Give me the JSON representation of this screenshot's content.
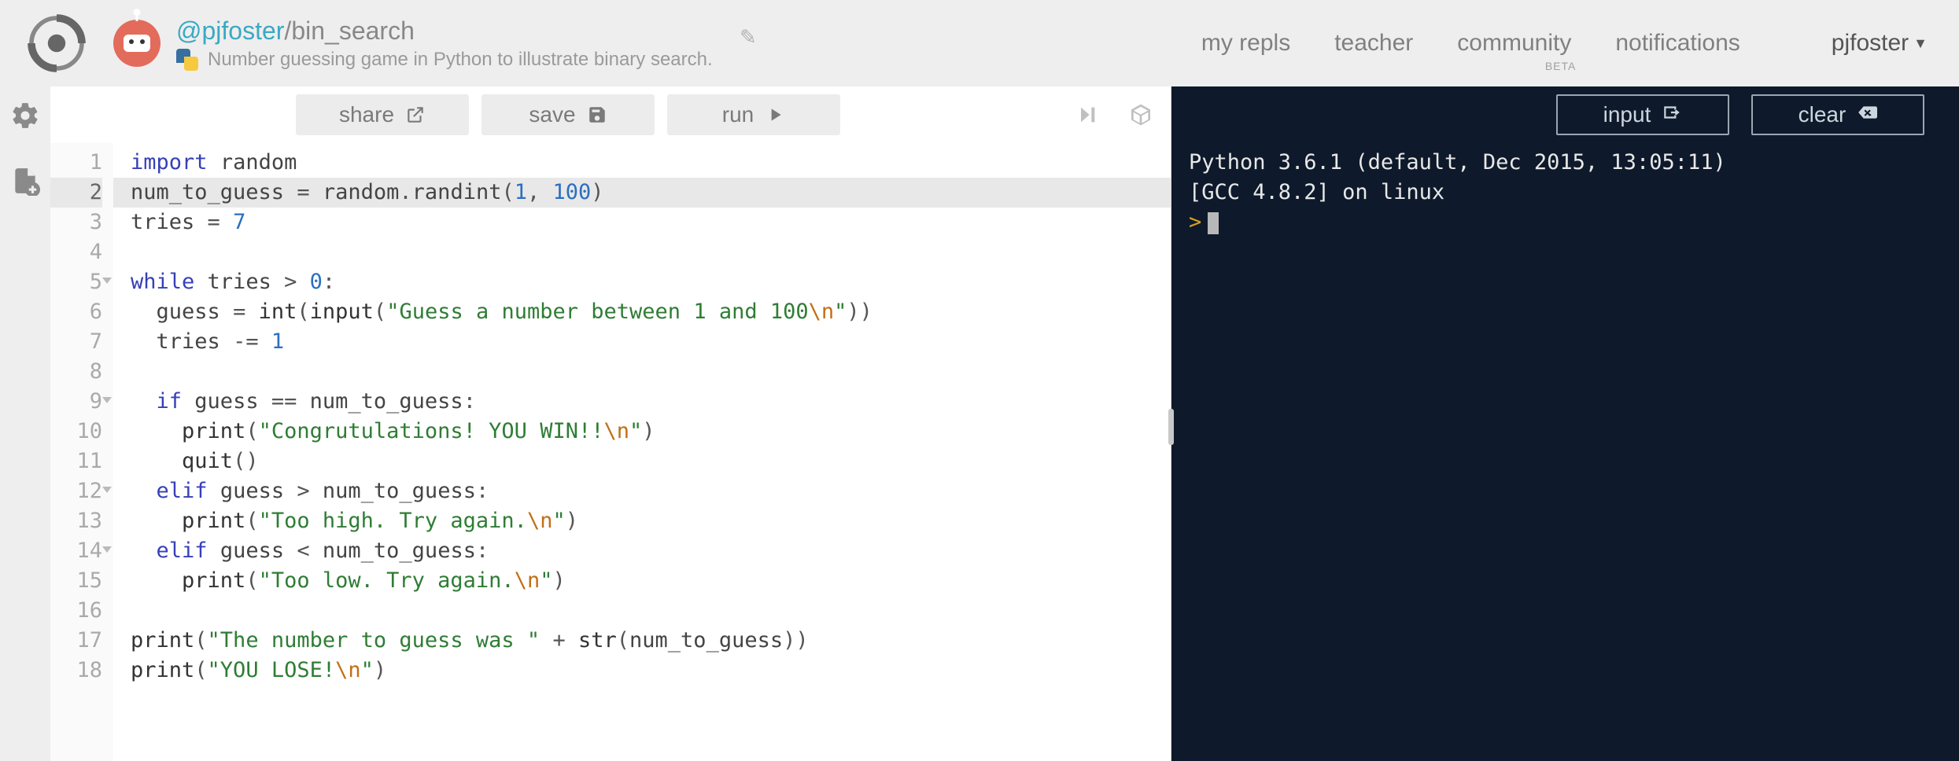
{
  "header": {
    "user_handle": "@pjfoster",
    "separator": "/",
    "repl_name": "bin_search",
    "language": "Python",
    "description": "Number guessing game in Python to illustrate binary search."
  },
  "nav": {
    "my_repls": "my repls",
    "teacher": "teacher",
    "community": "community",
    "community_beta": "BETA",
    "notifications": "notifications",
    "username": "pjfoster"
  },
  "toolbar": {
    "share": "share",
    "save": "save",
    "run": "run"
  },
  "console_toolbar": {
    "input": "input",
    "clear": "clear"
  },
  "editor": {
    "highlighted_line": 2,
    "fold_lines": [
      5,
      9,
      12,
      14
    ],
    "line_count": 18,
    "code": [
      {
        "t": [
          {
            "c": "kw",
            "s": "import"
          },
          {
            "c": "",
            "s": " "
          },
          {
            "c": "id",
            "s": "random"
          }
        ]
      },
      {
        "t": [
          {
            "c": "id",
            "s": "num_to_guess "
          },
          {
            "c": "op",
            "s": "="
          },
          {
            "c": "",
            "s": " "
          },
          {
            "c": "id",
            "s": "random"
          },
          {
            "c": "op",
            "s": "."
          },
          {
            "c": "id",
            "s": "randint"
          },
          {
            "c": "op",
            "s": "("
          },
          {
            "c": "num",
            "s": "1"
          },
          {
            "c": "op",
            "s": ", "
          },
          {
            "c": "num",
            "s": "100"
          },
          {
            "c": "op",
            "s": ")"
          }
        ]
      },
      {
        "t": [
          {
            "c": "id",
            "s": "tries "
          },
          {
            "c": "op",
            "s": "="
          },
          {
            "c": "",
            "s": " "
          },
          {
            "c": "num",
            "s": "7"
          }
        ]
      },
      {
        "t": []
      },
      {
        "t": [
          {
            "c": "kw",
            "s": "while"
          },
          {
            "c": "",
            "s": " "
          },
          {
            "c": "id",
            "s": "tries"
          },
          {
            "c": "",
            "s": " "
          },
          {
            "c": "op",
            "s": ">"
          },
          {
            "c": "",
            "s": " "
          },
          {
            "c": "num",
            "s": "0"
          },
          {
            "c": "op",
            "s": ":"
          }
        ]
      },
      {
        "t": [
          {
            "c": "",
            "s": "  "
          },
          {
            "c": "id",
            "s": "guess "
          },
          {
            "c": "op",
            "s": "="
          },
          {
            "c": "",
            "s": " "
          },
          {
            "c": "fn",
            "s": "int"
          },
          {
            "c": "op",
            "s": "("
          },
          {
            "c": "fn",
            "s": "input"
          },
          {
            "c": "op",
            "s": "("
          },
          {
            "c": "str",
            "s": "\"Guess a number between 1 and 100"
          },
          {
            "c": "esc",
            "s": "\\n"
          },
          {
            "c": "str",
            "s": "\""
          },
          {
            "c": "op",
            "s": "))"
          }
        ]
      },
      {
        "t": [
          {
            "c": "",
            "s": "  "
          },
          {
            "c": "id",
            "s": "tries "
          },
          {
            "c": "op",
            "s": "-="
          },
          {
            "c": "",
            "s": " "
          },
          {
            "c": "num",
            "s": "1"
          }
        ]
      },
      {
        "t": []
      },
      {
        "t": [
          {
            "c": "",
            "s": "  "
          },
          {
            "c": "kw",
            "s": "if"
          },
          {
            "c": "",
            "s": " "
          },
          {
            "c": "id",
            "s": "guess"
          },
          {
            "c": "",
            "s": " "
          },
          {
            "c": "op",
            "s": "=="
          },
          {
            "c": "",
            "s": " "
          },
          {
            "c": "id",
            "s": "num_to_guess"
          },
          {
            "c": "op",
            "s": ":"
          }
        ]
      },
      {
        "t": [
          {
            "c": "",
            "s": "    "
          },
          {
            "c": "fn",
            "s": "print"
          },
          {
            "c": "op",
            "s": "("
          },
          {
            "c": "str",
            "s": "\"Congrutulations! YOU WIN!!"
          },
          {
            "c": "esc",
            "s": "\\n"
          },
          {
            "c": "str",
            "s": "\""
          },
          {
            "c": "op",
            "s": ")"
          }
        ]
      },
      {
        "t": [
          {
            "c": "",
            "s": "    "
          },
          {
            "c": "fn",
            "s": "quit"
          },
          {
            "c": "op",
            "s": "()"
          }
        ]
      },
      {
        "t": [
          {
            "c": "",
            "s": "  "
          },
          {
            "c": "kw",
            "s": "elif"
          },
          {
            "c": "",
            "s": " "
          },
          {
            "c": "id",
            "s": "guess"
          },
          {
            "c": "",
            "s": " "
          },
          {
            "c": "op",
            "s": ">"
          },
          {
            "c": "",
            "s": " "
          },
          {
            "c": "id",
            "s": "num_to_guess"
          },
          {
            "c": "op",
            "s": ":"
          }
        ]
      },
      {
        "t": [
          {
            "c": "",
            "s": "    "
          },
          {
            "c": "fn",
            "s": "print"
          },
          {
            "c": "op",
            "s": "("
          },
          {
            "c": "str",
            "s": "\"Too high. Try again."
          },
          {
            "c": "esc",
            "s": "\\n"
          },
          {
            "c": "str",
            "s": "\""
          },
          {
            "c": "op",
            "s": ")"
          }
        ]
      },
      {
        "t": [
          {
            "c": "",
            "s": "  "
          },
          {
            "c": "kw",
            "s": "elif"
          },
          {
            "c": "",
            "s": " "
          },
          {
            "c": "id",
            "s": "guess"
          },
          {
            "c": "",
            "s": " "
          },
          {
            "c": "op",
            "s": "<"
          },
          {
            "c": "",
            "s": " "
          },
          {
            "c": "id",
            "s": "num_to_guess"
          },
          {
            "c": "op",
            "s": ":"
          }
        ]
      },
      {
        "t": [
          {
            "c": "",
            "s": "    "
          },
          {
            "c": "fn",
            "s": "print"
          },
          {
            "c": "op",
            "s": "("
          },
          {
            "c": "str",
            "s": "\"Too low. Try again."
          },
          {
            "c": "esc",
            "s": "\\n"
          },
          {
            "c": "str",
            "s": "\""
          },
          {
            "c": "op",
            "s": ")"
          }
        ]
      },
      {
        "t": []
      },
      {
        "t": [
          {
            "c": "fn",
            "s": "print"
          },
          {
            "c": "op",
            "s": "("
          },
          {
            "c": "str",
            "s": "\"The number to guess was \""
          },
          {
            "c": "",
            "s": " "
          },
          {
            "c": "op",
            "s": "+"
          },
          {
            "c": "",
            "s": " "
          },
          {
            "c": "fn",
            "s": "str"
          },
          {
            "c": "op",
            "s": "("
          },
          {
            "c": "id",
            "s": "num_to_guess"
          },
          {
            "c": "op",
            "s": "))"
          }
        ]
      },
      {
        "t": [
          {
            "c": "fn",
            "s": "print"
          },
          {
            "c": "op",
            "s": "("
          },
          {
            "c": "str",
            "s": "\"YOU LOSE!"
          },
          {
            "c": "esc",
            "s": "\\n"
          },
          {
            "c": "str",
            "s": "\""
          },
          {
            "c": "op",
            "s": ")"
          }
        ]
      }
    ]
  },
  "console": {
    "line1": "Python 3.6.1 (default, Dec 2015, 13:05:11)",
    "line2": "[GCC 4.8.2] on linux",
    "prompt": ">"
  }
}
